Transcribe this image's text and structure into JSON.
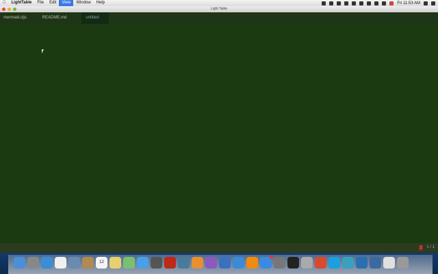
{
  "menubar": {
    "apple": "",
    "app": "LightTable",
    "items": [
      "File",
      "Edit",
      "View",
      "Window",
      "Help"
    ],
    "selected": "View",
    "clock": "Fri 11:53 AM"
  },
  "window": {
    "title": "Light Table"
  },
  "tabs": [
    {
      "label": "mermaid.cljs",
      "active": false
    },
    {
      "label": "README.md",
      "active": false
    },
    {
      "label": "untitled",
      "active": true
    }
  ],
  "statusbar": {
    "errors": "2",
    "position": "1 / 1"
  },
  "colors": {
    "editor_bg": "#1b3a12",
    "tab_bar": "#1f3517",
    "status_bar": "#2c3a1d",
    "accent": "#3b78e7"
  },
  "dock": [
    {
      "name": "finder",
      "color": "#4a8fd8"
    },
    {
      "name": "launchpad",
      "color": "#888"
    },
    {
      "name": "safari",
      "color": "#3a8ed8"
    },
    {
      "name": "photos",
      "color": "#f0f0f0"
    },
    {
      "name": "preview",
      "color": "#6a8ab0"
    },
    {
      "name": "contacts",
      "color": "#b08a50"
    },
    {
      "name": "calendar",
      "color": "#f4f4f4",
      "label": "12"
    },
    {
      "name": "notes",
      "color": "#e8d070"
    },
    {
      "name": "maps",
      "color": "#7ac070"
    },
    {
      "name": "messages",
      "color": "#4aa0e8"
    },
    {
      "name": "facetime",
      "color": "#555"
    },
    {
      "name": "photo-booth",
      "color": "#c02818"
    },
    {
      "name": "iphoto",
      "color": "#4a7a9a"
    },
    {
      "name": "pages",
      "color": "#e89030"
    },
    {
      "name": "numbers",
      "color": "#8a5ac0"
    },
    {
      "name": "keynote",
      "color": "#3a70c0"
    },
    {
      "name": "itunes",
      "color": "#3a8ad8"
    },
    {
      "name": "ibooks",
      "color": "#f08a10"
    },
    {
      "name": "app-store",
      "color": "#3a8ae0",
      "badge": true
    },
    {
      "name": "system-preferences",
      "color": "#777"
    },
    {
      "name": "terminal",
      "color": "#222"
    },
    {
      "name": "utility",
      "color": "#aaa"
    },
    {
      "name": "chrome",
      "color": "#d84a30"
    },
    {
      "name": "skype",
      "color": "#1aa0e0"
    },
    {
      "name": "quicktime",
      "color": "#3aa0c0"
    },
    {
      "name": "light-table",
      "color": "#2a70b0"
    },
    {
      "name": "network",
      "color": "#3a6aa0"
    },
    {
      "name": "downloads",
      "color": "#e0e0e0"
    },
    {
      "name": "trash",
      "color": "#999"
    }
  ]
}
